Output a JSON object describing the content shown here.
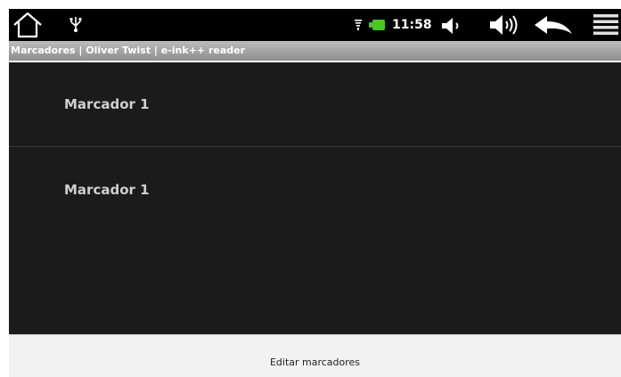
{
  "status_bar": {
    "time": "11:58",
    "icons": [
      "home-icon",
      "usb-icon",
      "signal-icon",
      "battery-icon",
      "volume-down-icon",
      "volume-up-icon",
      "back-icon",
      "menu-icon"
    ],
    "colors": {
      "background": "#000000",
      "battery": "#4ac726"
    }
  },
  "title_bar": {
    "title": "Marcadores | Oliver Twist | e-ink++ reader"
  },
  "bookmarks": {
    "items": [
      {
        "label": "Marcador 1"
      },
      {
        "label": "Marcador 1"
      }
    ]
  },
  "bottom_bar": {
    "edit_label": "Editar marcadores"
  }
}
